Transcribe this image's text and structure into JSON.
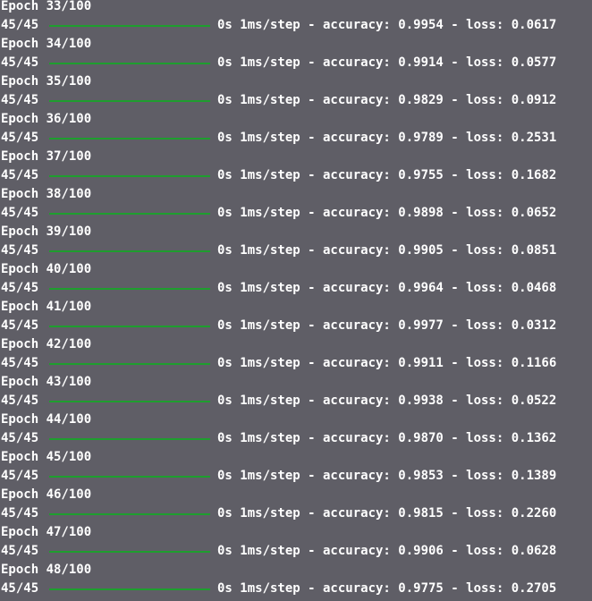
{
  "progress_label": "45/45",
  "progress_bar_fill": 1.0,
  "epochs": [
    {
      "epoch": "Epoch 33/100",
      "stats": "0s 1ms/step - accuracy: 0.9954 - loss: 0.0617"
    },
    {
      "epoch": "Epoch 34/100",
      "stats": "0s 1ms/step - accuracy: 0.9914 - loss: 0.0577"
    },
    {
      "epoch": "Epoch 35/100",
      "stats": "0s 1ms/step - accuracy: 0.9829 - loss: 0.0912"
    },
    {
      "epoch": "Epoch 36/100",
      "stats": "0s 1ms/step - accuracy: 0.9789 - loss: 0.2531"
    },
    {
      "epoch": "Epoch 37/100",
      "stats": "0s 1ms/step - accuracy: 0.9755 - loss: 0.1682"
    },
    {
      "epoch": "Epoch 38/100",
      "stats": "0s 1ms/step - accuracy: 0.9898 - loss: 0.0652"
    },
    {
      "epoch": "Epoch 39/100",
      "stats": "0s 1ms/step - accuracy: 0.9905 - loss: 0.0851"
    },
    {
      "epoch": "Epoch 40/100",
      "stats": "0s 1ms/step - accuracy: 0.9964 - loss: 0.0468"
    },
    {
      "epoch": "Epoch 41/100",
      "stats": "0s 1ms/step - accuracy: 0.9977 - loss: 0.0312"
    },
    {
      "epoch": "Epoch 42/100",
      "stats": "0s 1ms/step - accuracy: 0.9911 - loss: 0.1166"
    },
    {
      "epoch": "Epoch 43/100",
      "stats": "0s 1ms/step - accuracy: 0.9938 - loss: 0.0522"
    },
    {
      "epoch": "Epoch 44/100",
      "stats": "0s 1ms/step - accuracy: 0.9870 - loss: 0.1362"
    },
    {
      "epoch": "Epoch 45/100",
      "stats": "0s 1ms/step - accuracy: 0.9853 - loss: 0.1389"
    },
    {
      "epoch": "Epoch 46/100",
      "stats": "0s 1ms/step - accuracy: 0.9815 - loss: 0.2260"
    },
    {
      "epoch": "Epoch 47/100",
      "stats": "0s 1ms/step - accuracy: 0.9906 - loss: 0.0628"
    },
    {
      "epoch": "Epoch 48/100",
      "stats": "0s 1ms/step - accuracy: 0.9775 - loss: 0.2705"
    }
  ],
  "colors": {
    "background": "#5f5e66",
    "text": "#ffffff",
    "progress_bar": "#1e9e2e"
  }
}
